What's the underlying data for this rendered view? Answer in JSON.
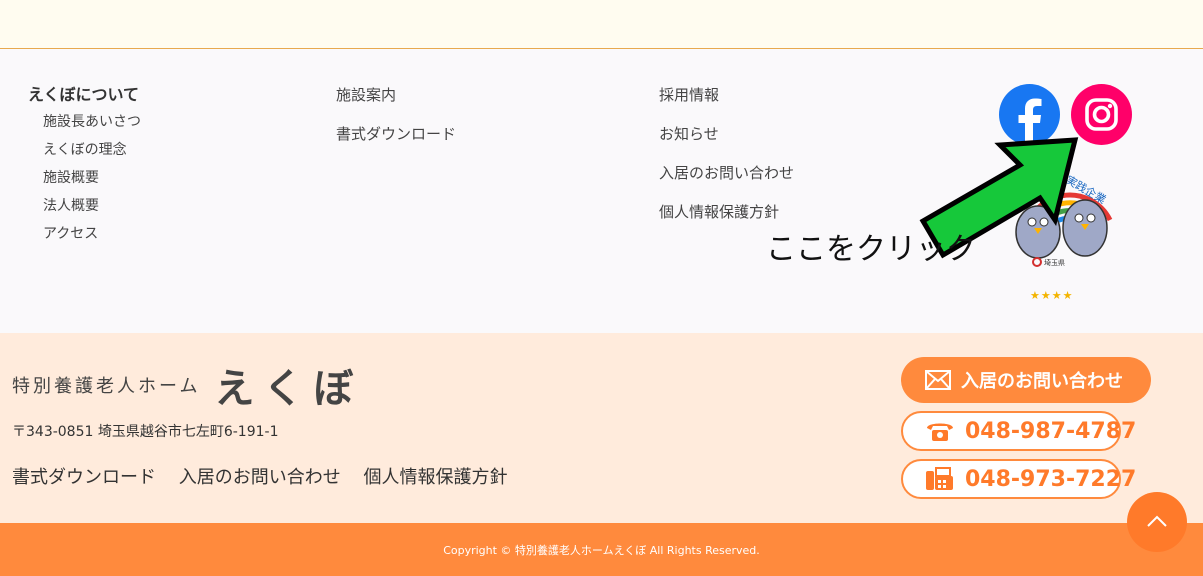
{
  "nav": {
    "col1": {
      "heading": "えくぼについて",
      "items": [
        "施設長あいさつ",
        "えくぼの理念",
        "施設概要",
        "法人概要",
        "アクセス"
      ]
    },
    "col2": {
      "items": [
        "施設案内",
        "書式ダウンロード"
      ]
    },
    "col3": {
      "items": [
        "採用情報",
        "お知らせ",
        "入居のお問い合わせ",
        "個人情報保護方針"
      ]
    }
  },
  "social": {
    "facebook_icon": "facebook-icon",
    "instagram_icon": "instagram-icon"
  },
  "annotation": {
    "text": "ここをクリック",
    "arrow_color": "#16c83a"
  },
  "badge": {
    "text": "実践企業",
    "org": "埼玉県",
    "stars": "★★★★"
  },
  "footer": {
    "brand_sub": "特別養護老人ホーム",
    "brand_main": "えくぼ",
    "address": "〒343-0851 埼玉県越谷市七左町6-191-1",
    "links": [
      "書式ダウンロード",
      "入居のお問い合わせ",
      "個人情報保護方針"
    ],
    "contact_button": "入居のお問い合わせ",
    "tel": "048-987-4787",
    "fax": "048-973-7227",
    "copyright": "Copyright © 特別養護老人ホームえくぼ All Rights Reserved."
  },
  "colors": {
    "accent": "#ff8a3d",
    "facebook": "#1877f2",
    "instagram": "#ff0069",
    "footer_bg": "#ffebdc"
  }
}
